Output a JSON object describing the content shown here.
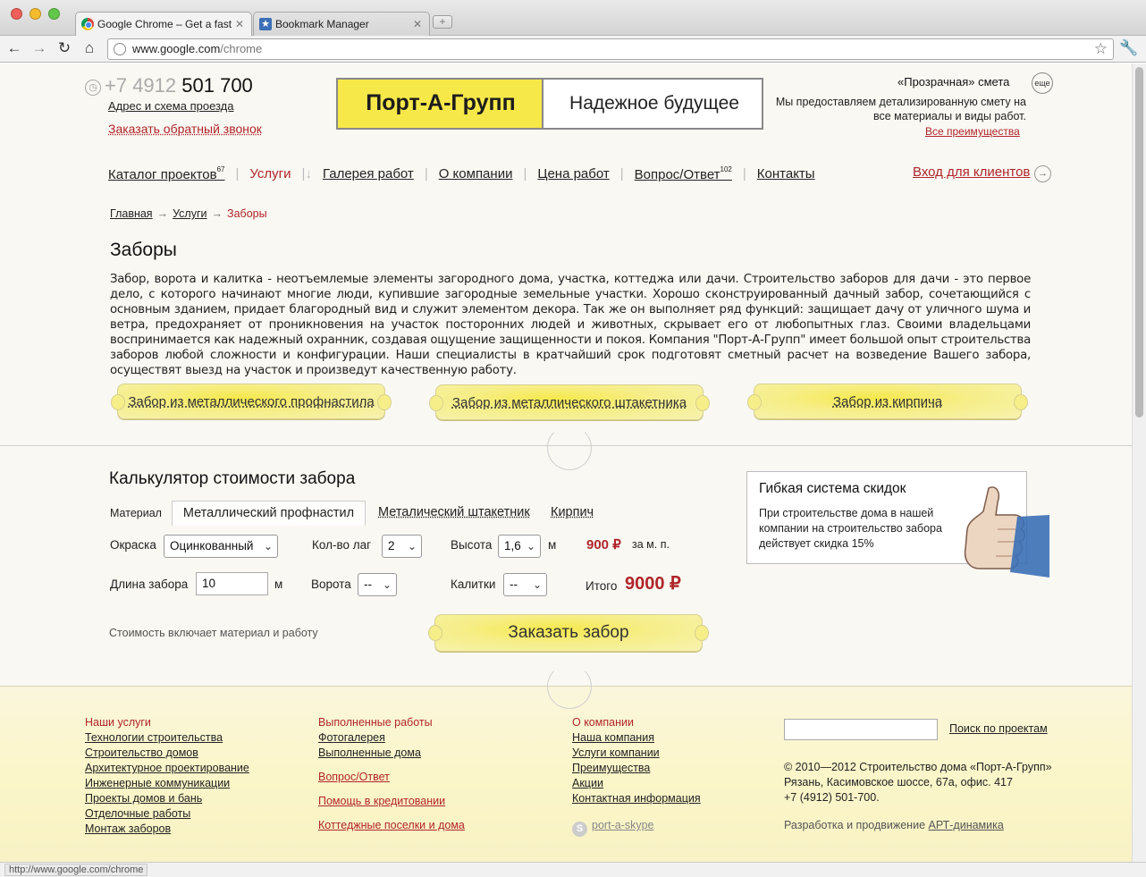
{
  "browser": {
    "tabs": [
      {
        "title": "Google Chrome – Get a fast",
        "active": true
      },
      {
        "title": "Bookmark Manager",
        "active": false
      }
    ],
    "url_host": "www.google.com",
    "url_path": "/chrome",
    "status_url": "http://www.google.com/chrome"
  },
  "header": {
    "phone_prefix": "+7 4912",
    "phone_number": "501 700",
    "address_link": "Адрес и схема проезда",
    "callback_link": "Заказать обратный звонок",
    "logo_name": "Порт-А-Групп",
    "logo_tagline": "Надежное будущее",
    "smeta_title": "«Прозрачная» смета",
    "smeta_more": "еще",
    "smeta_text": "Мы предоставляем детализированную смету на все материалы и виды работ.",
    "smeta_link": "Все преимущества"
  },
  "nav": {
    "items": [
      {
        "label": "Каталог проектов",
        "sup": "67"
      },
      {
        "label": "Услуги",
        "sup": ""
      },
      {
        "label": "Галерея работ",
        "sup": ""
      },
      {
        "label": "О компании",
        "sup": ""
      },
      {
        "label": "Цена работ",
        "sup": ""
      },
      {
        "label": "Вопрос/Ответ",
        "sup": "102"
      },
      {
        "label": "Контакты",
        "sup": ""
      }
    ],
    "login": "Вход для клиентов"
  },
  "breadcrumbs": [
    "Главная",
    "Услуги",
    "Заборы"
  ],
  "content": {
    "title": "Заборы",
    "intro": "Забор, ворота и калитка - неотъемлемые элементы загородного дома, участка, коттеджа или дачи. Строительство заборов для дачи - это первое дело, с которого начинают многие люди, купившие загородные земельные участки. Хорошо сконструированный дачный забор, сочетающийся с основным зданием, придает благородный вид и служит элементом декора. Так же он выполняет ряд функций: защищает дачу от уличного шума и ветра, предохраняет от проникновения на участок посторонних людей и животных, скрывает его от любопытных глаз. Своими владельцами воспринимается как надежный охранник, создавая ощущение защищенности и покоя. Компания \"Порт-А-Групп\" имеет большой опыт строительства заборов любой сложности и конфигурации. Наши специалисты в кратчайший срок подготовят сметный расчет на возведение Вашего забора, осуществят выезд на участок и произведут качественную работу.",
    "type_buttons": [
      "Забор из металлического профнастила",
      "Забор из металлического штакетника",
      "Забор из кирпича"
    ]
  },
  "calculator": {
    "title": "Калькулятор стоимости  забора",
    "material_label": "Материал",
    "material_tabs": [
      "Металлический профнастил",
      "Металический штакетник",
      "Кирпич"
    ],
    "paint_label": "Окраска",
    "paint_value": "Оцинкованный",
    "logs_label": "Кол-во лаг",
    "logs_value": "2",
    "height_label": "Высота",
    "height_value": "1,6",
    "height_unit": "м",
    "price": "900 ₽",
    "price_unit": "за м. п.",
    "length_label": "Длина забора",
    "length_value": "10",
    "length_unit": "м",
    "gate_label": "Ворота",
    "gate_value": "--",
    "wicket_label": "Калитки",
    "wicket_value": "--",
    "total_label": "Итого",
    "total_value": "9000 ₽",
    "note": "Стоимость включает материал и работу",
    "order_button": "Заказать забор"
  },
  "discount": {
    "title": "Гибкая система скидок",
    "text": "При строительстве дома в нашей компании на строительство забора действует скидка 15%"
  },
  "footer": {
    "col1": {
      "heading": "Наши услуги",
      "links": [
        "Технологии строительства",
        "Строительство домов",
        "Архитектурное проектирование",
        "Инженерные коммуникации",
        "Проекты домов и бань",
        "Отделочные работы",
        "Монтаж заборов"
      ]
    },
    "col2": {
      "heading": "Выполненные работы",
      "links": [
        "Фотогалерея",
        "Выполненные дома"
      ],
      "red_links": [
        "Вопрос/Ответ",
        "Помощь в кредитовании",
        "Коттеджные поселки и дома"
      ]
    },
    "col3": {
      "heading": "О компании",
      "links": [
        "Наша компания",
        "Услуги компании",
        "Преимущества",
        "Акции",
        "Контактная информация"
      ],
      "skype": "port-a-skype"
    },
    "search_button": "Поиск по проектам",
    "copyright_lines": [
      "© 2010—2012 Строительство дома «Порт-А-Групп»",
      "Рязань, Касимовское шоссе, 67а, офис. 417",
      "+7 (4912) 501-700."
    ],
    "dev_text": "Разработка и продвижение",
    "dev_link": "АРТ-динамика"
  },
  "colors": {
    "accent_red": "#b0252a",
    "brand_yellow": "#f7e84a"
  }
}
